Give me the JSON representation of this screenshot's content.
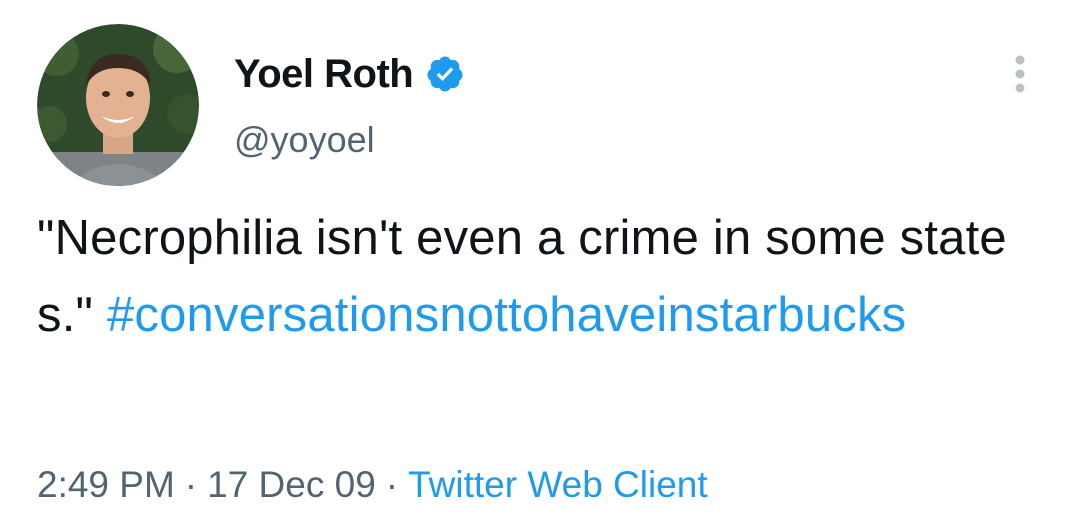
{
  "author": {
    "display_name": "Yoel Roth",
    "handle": "@yoyoel",
    "verified": true
  },
  "tweet": {
    "text": "\"Necrophilia isn't even a crime in some states.\"",
    "hashtag": "#conversationsnottohaveinstarbucks"
  },
  "meta": {
    "time": "2:49 PM",
    "separator": "·",
    "date": "17 Dec 09",
    "source": "Twitter Web Client"
  },
  "icons": {
    "verified": "verified-badge-icon",
    "more": "more-options-icon"
  },
  "colors": {
    "accent": "#1d9bf0",
    "secondary_text": "#536471",
    "primary_text": "#0f1419"
  }
}
